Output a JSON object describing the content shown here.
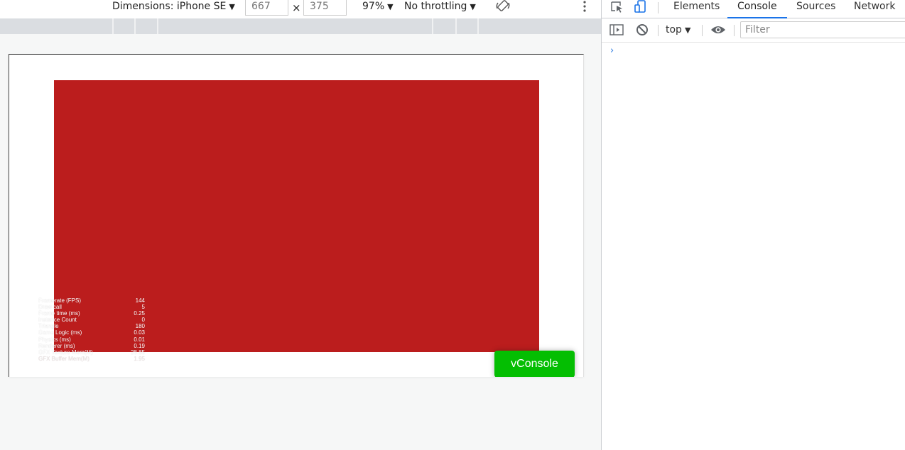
{
  "toolbar": {
    "dimensions_label": "Dimensions: iPhone SE",
    "width_value": "667",
    "times_sign": "×",
    "height_value": "375",
    "zoom_label": "97%",
    "throttling_label": "No throttling",
    "caret": "▼",
    "more_icon": "kebab-vertical-icon",
    "rotate_icon": "rotate-icon"
  },
  "page": {
    "canvas_color": "#bb1d1d",
    "stats": [
      {
        "label": "Framerate (FPS)",
        "value": "144"
      },
      {
        "label": "Draw call",
        "value": "5"
      },
      {
        "label": "Frame time (ms)",
        "value": "0.25"
      },
      {
        "label": "Instance Count",
        "value": "0"
      },
      {
        "label": "Triangle",
        "value": "180"
      },
      {
        "label": "Game Logic (ms)",
        "value": "0.03"
      },
      {
        "label": "Physics (ms)",
        "value": "0.01"
      },
      {
        "label": "Renderer (ms)",
        "value": "0.19"
      },
      {
        "label": "GFX Texture Mem(M)",
        "value": "28.85"
      },
      {
        "label": "GFX Buffer Mem(M)",
        "value": "1.95"
      }
    ],
    "vconsole_label": "vConsole",
    "vconsole_color": "#04be02"
  },
  "devtools": {
    "tabs": [
      "Elements",
      "Console",
      "Sources",
      "Network"
    ],
    "active_tab": "Console",
    "context_label": "top",
    "caret": "▼",
    "filter_placeholder": "Filter",
    "prompt_symbol": "›",
    "accent_color": "#1a73e8"
  }
}
